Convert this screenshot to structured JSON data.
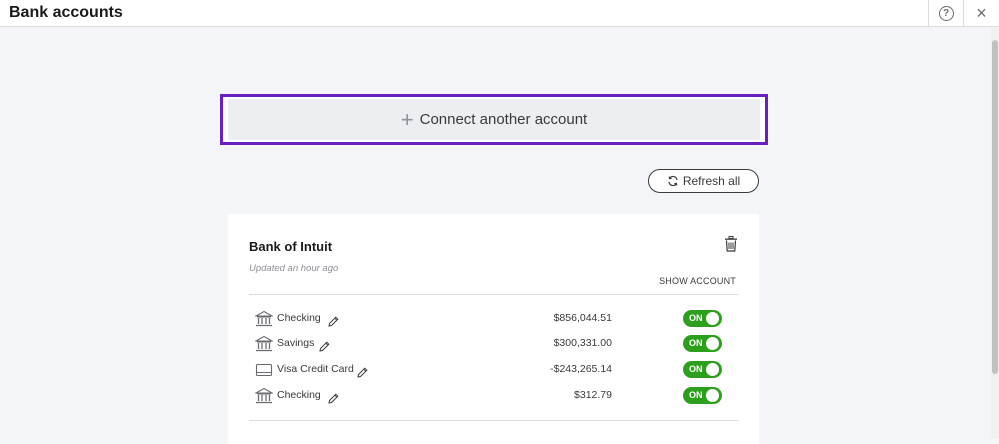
{
  "header": {
    "title": "Bank accounts",
    "help_label": "?",
    "close_label": "×"
  },
  "connect": {
    "label": "Connect another account",
    "plus": "+"
  },
  "refresh": {
    "label": "Refresh all"
  },
  "bank": {
    "name": "Bank of Intuit",
    "updated": "Updated an hour ago",
    "show_account": "SHOW ACCOUNT",
    "accounts": [
      {
        "name": "Checking",
        "balance": "$856,044.51",
        "toggle": "ON",
        "icon": "bank-icon"
      },
      {
        "name": "Savings",
        "balance": "$300,331.00",
        "toggle": "ON",
        "icon": "bank-icon"
      },
      {
        "name": "Visa Credit Card",
        "balance": "-$243,265.14",
        "toggle": "ON",
        "icon": "credit-card-icon"
      },
      {
        "name": "Checking",
        "balance": "$312.79",
        "toggle": "ON",
        "icon": "bank-icon"
      }
    ]
  },
  "colors": {
    "accent_outline": "#6a1fbf",
    "toggle_on": "#2ca01c"
  }
}
